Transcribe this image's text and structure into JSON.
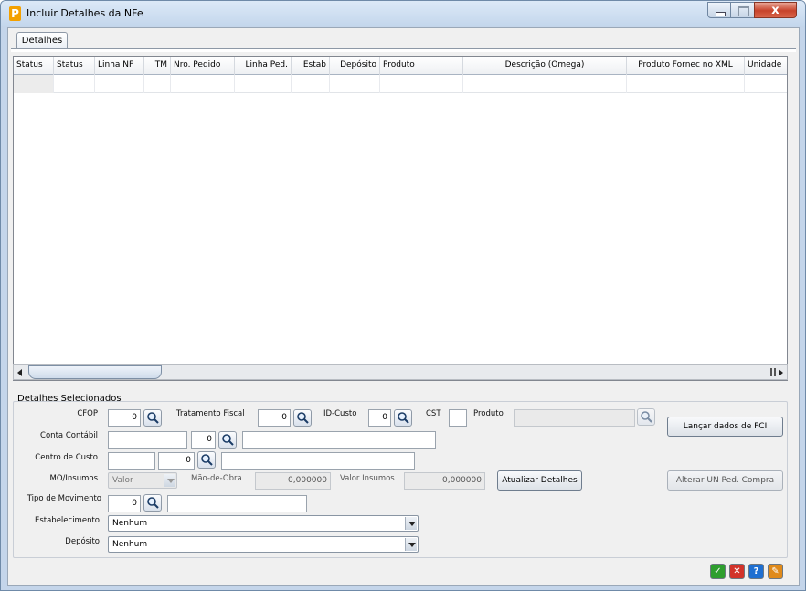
{
  "window": {
    "title": "Incluir Detalhes da NFe",
    "app_icon_letter": "P",
    "close_glyph": "x"
  },
  "tabs": [
    {
      "label": "Detalhes"
    }
  ],
  "grid": {
    "columns": [
      "Status",
      "Status",
      "Linha NF",
      "TM",
      "Nro. Pedido",
      "Linha Ped.",
      "Estab",
      "Depósito",
      "Produto",
      "Descrição (Omega)",
      "Produto Fornec no XML",
      "Unidade"
    ]
  },
  "detalhes": {
    "group_title": "Detalhes Selecionados",
    "cfop": {
      "label": "CFOP",
      "value": "0"
    },
    "tratamento_fiscal": {
      "label": "Tratamento Fiscal",
      "value": "0"
    },
    "id_custo": {
      "label": "ID-Custo",
      "value": "0"
    },
    "cst": {
      "label": "CST",
      "value": ""
    },
    "produto": {
      "label": "Produto",
      "value": ""
    },
    "conta_contabil": {
      "label": "Conta Contábil",
      "value": "",
      "code": "0",
      "desc": ""
    },
    "centro_custo": {
      "label": "Centro de Custo",
      "value": "",
      "code": "0",
      "desc": ""
    },
    "mo_insumos": {
      "label": "MO/Insumos",
      "value": "Valor"
    },
    "mao_de_obra": {
      "label": "Mão-de-Obra",
      "value": "0,000000"
    },
    "valor_insumos": {
      "label": "Valor Insumos",
      "value": "0,000000"
    },
    "tipo_movimento": {
      "label": "Tipo de Movimento",
      "value": "0",
      "desc": ""
    },
    "estabelecimento": {
      "label": "Estabelecimento",
      "value": "Nenhum"
    },
    "deposito": {
      "label": "Depósito",
      "value": "Nenhum"
    },
    "buttons": {
      "lancar_fci": "Lançar dados de FCI",
      "atualizar": "Atualizar Detalhes",
      "alterar_un": "Alterar UN Ped. Compra"
    }
  },
  "footer": {
    "icons": [
      {
        "name": "confirm-icon",
        "glyph": "✓",
        "color": "#2e9e2e"
      },
      {
        "name": "cancel-icon",
        "glyph": "✕",
        "color": "#d2332a"
      },
      {
        "name": "help-icon",
        "glyph": "?",
        "color": "#1f6fd1"
      },
      {
        "name": "tools-icon",
        "glyph": "✎",
        "color": "#e08a1a"
      }
    ]
  },
  "colors": {
    "title_bg": "#c4d5ea",
    "client_bg": "#f0f0f0",
    "close_red": "#c7432a"
  }
}
